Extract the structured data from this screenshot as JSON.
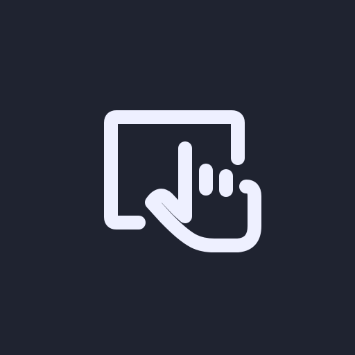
{
  "icon": {
    "name": "touch-screen-icon",
    "foreground": "#eef0ff",
    "background": "#1f2330"
  }
}
